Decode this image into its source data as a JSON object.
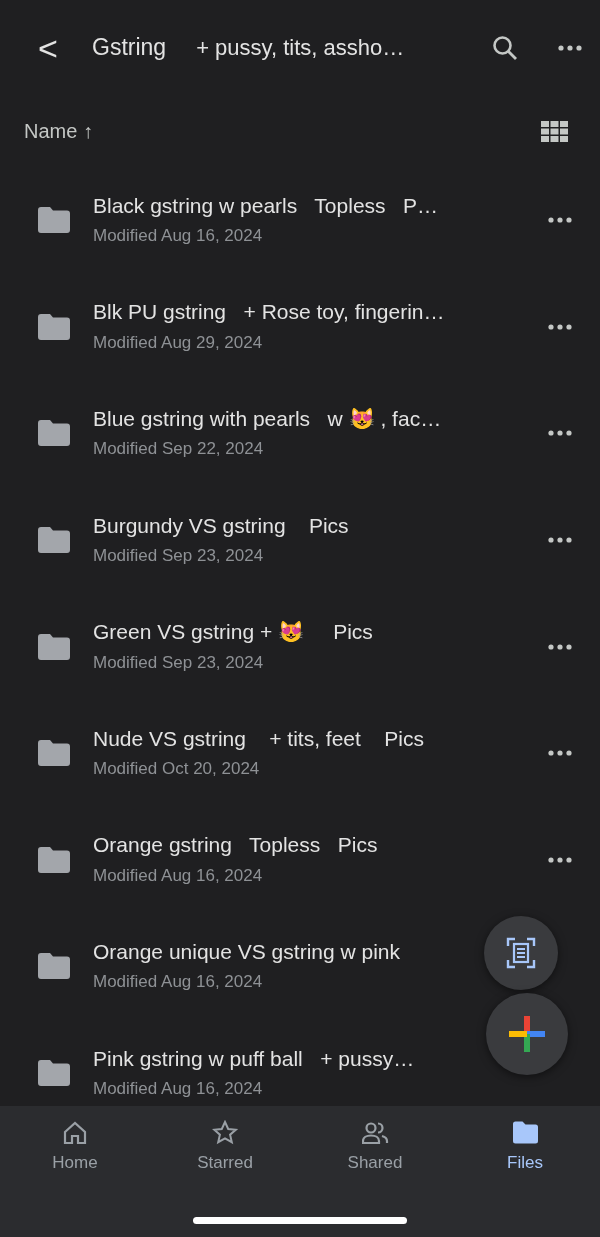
{
  "header": {
    "back": "<",
    "title": "Gstring",
    "subtitle": "+ pussy, tits, assho…"
  },
  "sort": {
    "label": "Name",
    "direction": "↑"
  },
  "folders": [
    {
      "name": "Black gstring w pearls   Topless   P…",
      "modified": "Modified Aug 16, 2024",
      "menu_visible": true
    },
    {
      "name": "Blk PU gstring   + Rose toy, fingerin…",
      "modified": "Modified Aug 29, 2024",
      "menu_visible": true
    },
    {
      "name": "Blue gstring with pearls   w 😻 , fac…",
      "modified": "Modified Sep 22, 2024",
      "menu_visible": true
    },
    {
      "name": "Burgundy VS gstring    Pics",
      "modified": "Modified Sep 23, 2024",
      "menu_visible": true
    },
    {
      "name": "Green VS gstring + 😻     Pics",
      "modified": "Modified Sep 23, 2024",
      "menu_visible": true
    },
    {
      "name": "Nude VS gstring    + tits, feet    Pics",
      "modified": "Modified Oct 20, 2024",
      "menu_visible": true
    },
    {
      "name": "Orange gstring   Topless   Pics",
      "modified": "Modified Aug 16, 2024",
      "menu_visible": true
    },
    {
      "name": "Orange unique VS gstring w pink",
      "modified": "Modified Aug 16, 2024",
      "menu_visible": false
    },
    {
      "name": "Pink gstring w puff ball   + pussy…",
      "modified": "Modified Aug 16, 2024",
      "menu_visible": false
    }
  ],
  "nav": [
    {
      "kind": "home",
      "label": "Home",
      "selected": false
    },
    {
      "kind": "star",
      "label": "Starred",
      "selected": false
    },
    {
      "kind": "shared",
      "label": "Shared",
      "selected": false
    },
    {
      "kind": "files",
      "label": "Files",
      "selected": true
    }
  ]
}
